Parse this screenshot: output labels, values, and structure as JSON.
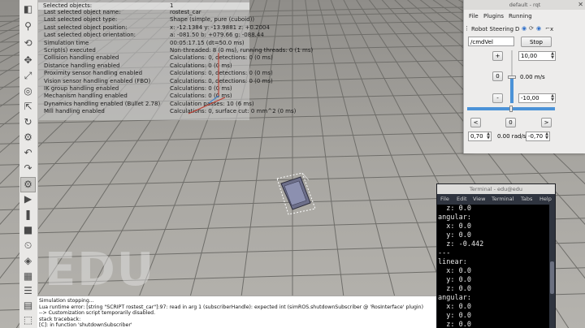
{
  "watermark": "EDU",
  "toolbar_icons": [
    "view-icon",
    "zoom-icon",
    "rotate-icon",
    "pan-icon",
    "fit-icon",
    "camera-icon",
    "object-shift-icon",
    "object-rotate-icon",
    "assemble-icon",
    "undo-icon",
    "redo-icon",
    "simulation-settings-icon",
    "play-icon",
    "pause-icon",
    "stop-icon",
    "realtime-icon",
    "dynamics-icon",
    "model-browser-icon",
    "scene-hierarchy-icon",
    "layers-icon",
    "selection-icon",
    "scripts-icon"
  ],
  "info_overlay": {
    "header": {
      "label": "Selected objects:",
      "value": "1"
    },
    "lines": [
      {
        "key": "Last selected object name:",
        "value": "rostest_car"
      },
      {
        "key": "Last selected object type:",
        "value": "Shape (simple, pure (cuboid))"
      },
      {
        "key": "Last selected object position:",
        "value": "x: -12.1384   y: -13.9881   z: +0.2004"
      },
      {
        "key": "Last selected object orientation:",
        "value": "a: -081.50   b: +079.66   g: -088.44"
      },
      {
        "key": "Simulation time",
        "value": "00:05:17.15 (dt=50.0 ms)"
      },
      {
        "key": "Script(s) executed",
        "value": "Non-threaded: 8 (0 ms), running threads: 0 (1 ms)"
      },
      {
        "key": "Collision handling enabled",
        "value": "Calculations: 0, detections: 0 (0 ms)"
      },
      {
        "key": "Distance handling enabled",
        "value": "Calculations: 0 (0 ms)"
      },
      {
        "key": "Proximity sensor handling enabled",
        "value": "Calculations: 0, detections: 0 (0 ms)"
      },
      {
        "key": "Vision sensor handling enabled (FBO)",
        "value": "Calculations: 0, detections: 0 (0 ms)"
      },
      {
        "key": "IK group handling enabled",
        "value": "Calculations: 0 (0 ms)"
      },
      {
        "key": "Mechanism handling enabled",
        "value": "Calculations: 0 (0 ms)"
      },
      {
        "key": "Dynamics handling enabled (Bullet 2.78)",
        "value": "Calculation passes: 10 (6 ms)"
      },
      {
        "key": "Mill handling enabled",
        "value": "Calculations: 0, surface cut: 0 mm^2 (0 ms)"
      }
    ]
  },
  "console": {
    "lines": [
      "Simulation stopping...",
      "Lua runtime error: [string \"SCRIPT rostest_car\"]:97: read in arg 1 (subscriberHandle): expected int (simROS.shutdownSubscriber @ 'RosInterface' plugin)",
      "--> Customization script temporarily disabled.",
      "stack traceback:",
      "                    [C]: in function 'shutdownSubscriber'"
    ]
  },
  "rqt": {
    "title": "default - rqt",
    "menu": {
      "file": "File",
      "plugins": "Plugins",
      "running": "Running"
    },
    "plugin_title": "Robot Steering",
    "plugin_buttons": {
      "d": "D",
      "close": "x"
    },
    "topic": "/cmdVel",
    "stop": "Stop",
    "linear": {
      "plus": "+",
      "zero": "0",
      "minus": "-",
      "max": "10,00",
      "min": "-10,00",
      "readout": "0.00 m/s",
      "value_fraction": 0.5
    },
    "angular": {
      "left": "<",
      "zero": "0",
      "right": ">",
      "min": "0,70",
      "max": "-0,70",
      "readout": "0.00 rad/s",
      "value_fraction": 0.5
    }
  },
  "terminal": {
    "title": "Terminal - edu@edu",
    "menu": [
      "File",
      "Edit",
      "View",
      "Terminal",
      "Tabs",
      "Help"
    ],
    "lines": [
      "  z: 0.0",
      "angular:",
      "  x: 0.0",
      "  y: 0.0",
      "  z: -0.442",
      "---",
      "linear:",
      "  x: 0.0",
      "  y: 0.0",
      "  z: 0.0",
      "angular:",
      "  x: 0.0",
      "  y: 0.0",
      "  z: 0.0",
      "---"
    ]
  }
}
